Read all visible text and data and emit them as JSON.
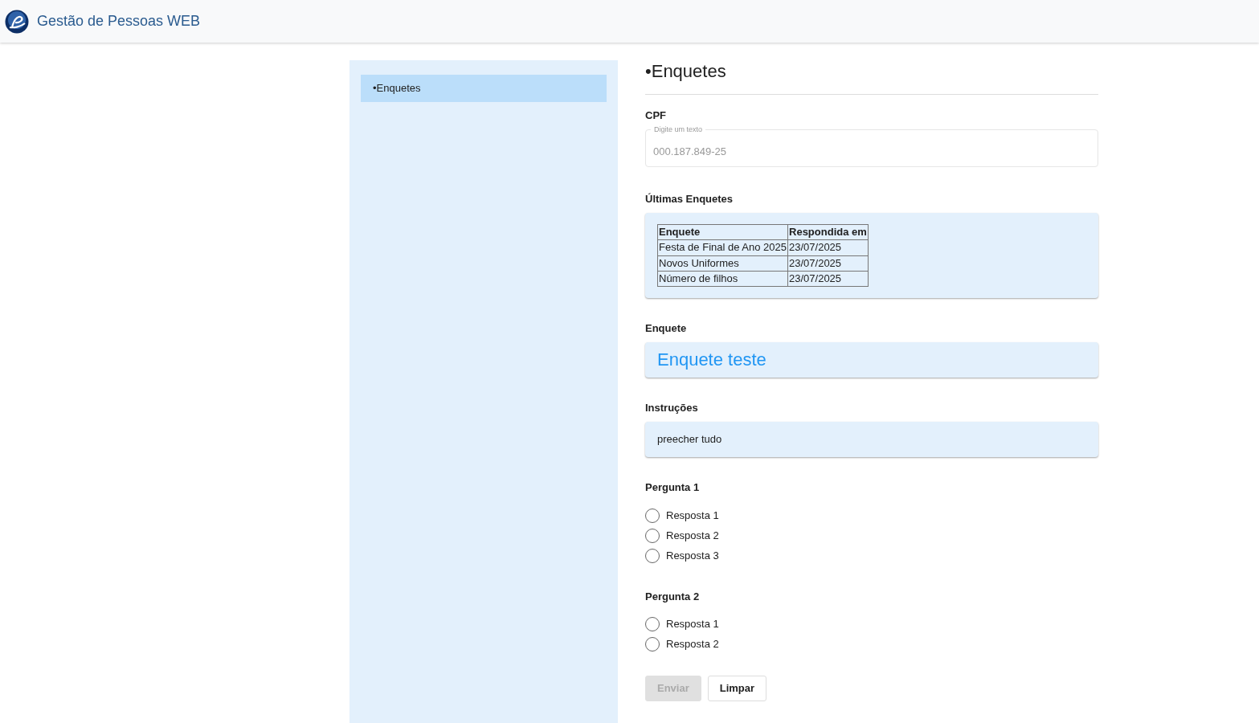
{
  "app": {
    "title": "Gestão de Pessoas WEB"
  },
  "sidebar": {
    "items": [
      {
        "label": "•Enquetes",
        "selected": true
      }
    ]
  },
  "page_title": "•Enquetes",
  "cpf": {
    "label": "CPF",
    "floating_label": "Digite um texto",
    "value": "000.187.849-25",
    "disabled": true
  },
  "recent": {
    "label": "Últimas Enquetes",
    "columns": [
      "Enquete",
      "Respondida em"
    ],
    "rows": [
      [
        "Festa de Final de Ano 2025",
        "23/07/2025"
      ],
      [
        "Novos Uniformes",
        "23/07/2025"
      ],
      [
        "Número de filhos",
        "23/07/2025"
      ]
    ]
  },
  "survey": {
    "label": "Enquete",
    "name": "Enquete teste"
  },
  "instructions": {
    "label": "Instruções",
    "text": "preecher tudo"
  },
  "questions": [
    {
      "label": "Pergunta 1",
      "options": [
        {
          "label": "Resposta 1",
          "selected": false
        },
        {
          "label": "Resposta 2",
          "selected": false
        },
        {
          "label": "Resposta 3",
          "selected": false
        }
      ]
    },
    {
      "label": "Pergunta 2",
      "options": [
        {
          "label": "Resposta 1",
          "selected": false
        },
        {
          "label": "Resposta 2",
          "selected": false
        }
      ]
    }
  ],
  "buttons": [
    {
      "label": "Enviar",
      "disabled": true
    },
    {
      "label": "Limpar",
      "disabled": false
    }
  ]
}
